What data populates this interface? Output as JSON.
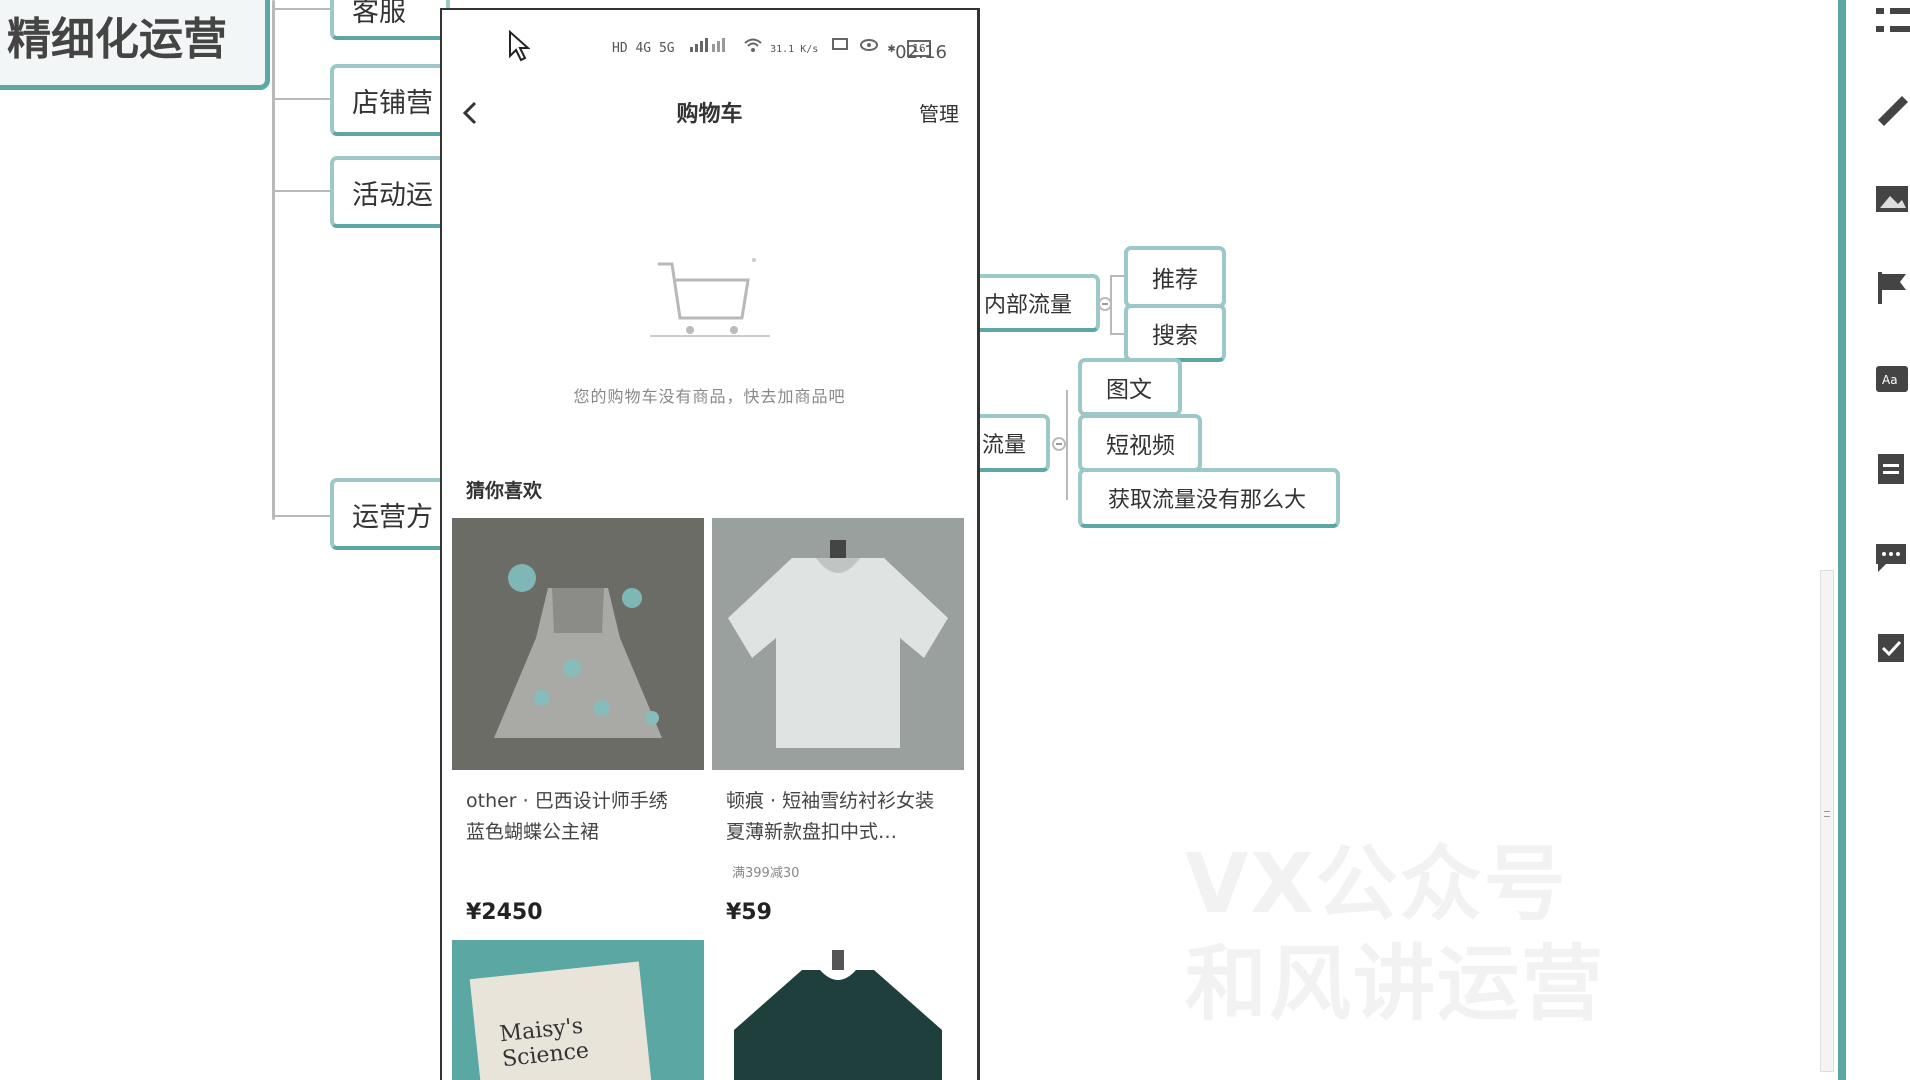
{
  "mindmap": {
    "root": "精细化运营",
    "branches": [
      "客服",
      "店铺营",
      "活动运",
      "运营方"
    ],
    "traffic_nodes": {
      "internal": "内部流量",
      "internal_children": [
        "推荐",
        "搜索"
      ],
      "other": "流量",
      "other_children": [
        "图文",
        "短视频",
        "获取流量没有那么大"
      ]
    }
  },
  "phone": {
    "status_bar": {
      "network": "HD 4G 5G",
      "speed": "31.1 K/s",
      "battery": "16",
      "time": "02:16"
    },
    "nav": {
      "back_icon": "chevron-left-icon",
      "title": "购物车",
      "manage": "管理"
    },
    "empty_cart": {
      "icon": "cart-icon",
      "message": "您的购物车没有商品，快去加商品吧"
    },
    "recommend": {
      "title": "猜你喜欢",
      "products": [
        {
          "title": "other · 巴西设计师手绣蓝色蝴蝶公主裙",
          "price": "¥2450",
          "promo": ""
        },
        {
          "title": "顿痕 · 短袖雪纺衬衫女装夏薄新款盘扣中式…",
          "price": "¥59",
          "promo": "满399减30"
        },
        {
          "title": "Maisy's Science",
          "price": "",
          "promo": ""
        },
        {
          "title": "",
          "price": "",
          "promo": ""
        }
      ]
    }
  },
  "watermark": {
    "line1": "VX公众号",
    "line2": "和风讲运营"
  },
  "toolbar": {
    "icons": [
      "outline-icon",
      "style-icon",
      "image-icon",
      "flag-icon",
      "text-icon",
      "note-icon",
      "comment-icon",
      "task-icon"
    ]
  },
  "colors": {
    "accent": "#5aa7a3",
    "node_border": "#9cc9c7"
  }
}
